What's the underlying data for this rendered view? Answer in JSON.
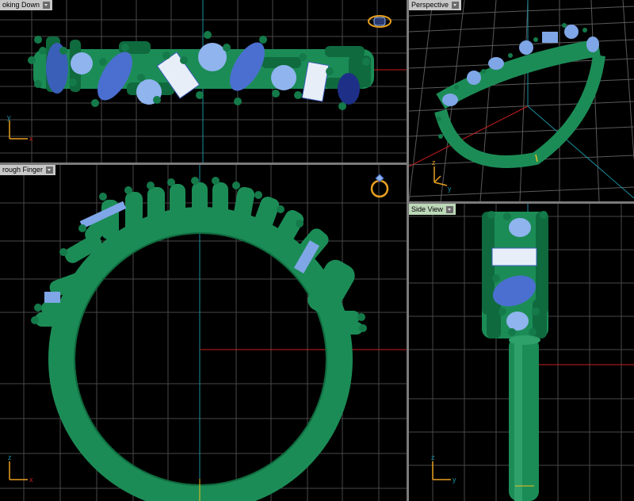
{
  "viewports": {
    "top": {
      "label": "oking Down"
    },
    "perspective": {
      "label": "Perspective"
    },
    "front": {
      "label": "rough Finger"
    },
    "side": {
      "label": "Side View"
    }
  },
  "axes": {
    "x": "x",
    "y": "y",
    "z": "z"
  },
  "colors": {
    "background": "#000000",
    "grid": "#4a4a4a",
    "axis_x": "#c81e1e",
    "axis_y": "#1a8fa0",
    "metal": "#1c8c56",
    "stone": "#7fa6e6",
    "stone_dark": "#3a5fb8",
    "gizmo": "#e8a020"
  },
  "icons": [
    "view-cube-icon",
    "ring-view-icon",
    "dropdown-icon",
    "axis-gizmo-icon"
  ]
}
